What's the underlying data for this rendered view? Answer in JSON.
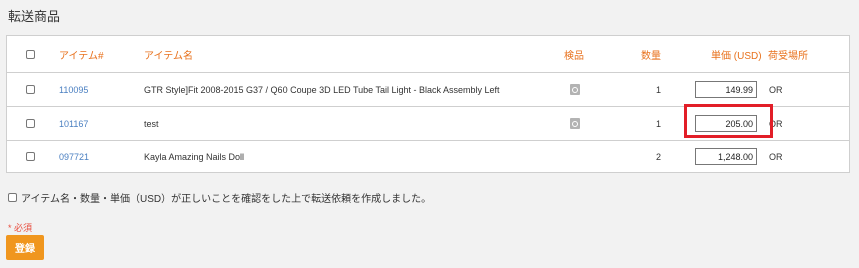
{
  "section_title": "転送商品",
  "table": {
    "headers": {
      "item_no": "アイテム#",
      "item_name": "アイテム名",
      "inspection": "検品",
      "quantity": "数量",
      "unit_price": "単価 (USD)",
      "receiving_location": "荷受場所"
    },
    "rows": [
      {
        "item_no": "110095",
        "item_name": "GTR Style]Fit 2008-2015 G37 / Q60 Coupe 3D LED Tube Tail Light - Black Assembly Left",
        "quantity": "1",
        "unit_price": "149.99",
        "location": "OR"
      },
      {
        "item_no": "101167",
        "item_name": "test",
        "quantity": "1",
        "unit_price": "205.00",
        "location": "OR"
      },
      {
        "item_no": "097721",
        "item_name": "Kayla Amazing Nails Doll",
        "quantity": "2",
        "unit_price": "1,248.00",
        "location": "OR"
      }
    ]
  },
  "confirm_text": "アイテム名・数量・単価（USD）が正しいことを確認をした上で転送依頼を作成しました。",
  "required_label": "* 必須",
  "submit_label": "登録",
  "colors": {
    "header_text": "#e8711c",
    "link": "#4a7fc1",
    "highlight": "#e21e28",
    "submit_button": "#f0961e"
  },
  "icons": {
    "inspection": "inspect-icon"
  }
}
